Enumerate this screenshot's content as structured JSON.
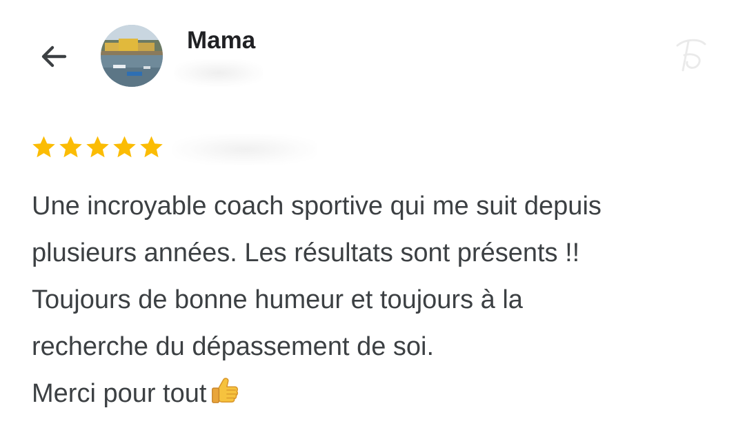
{
  "header": {
    "back_icon": "arrow-left-icon",
    "reviewer_name": "Mama",
    "avatar_alt": "avatar"
  },
  "review": {
    "rating": 5,
    "rating_max": 5,
    "star_color": "#fbbc04",
    "lines": [
      "Une incroyable coach sportive qui me suit depuis",
      "plusieurs années. Les résultats sont présents !!",
      "Toujours de bonne humeur et toujours à la",
      "recherche du dépassement de soi.",
      "Merci pour tout"
    ],
    "emoji": "thumbs-up-icon"
  }
}
